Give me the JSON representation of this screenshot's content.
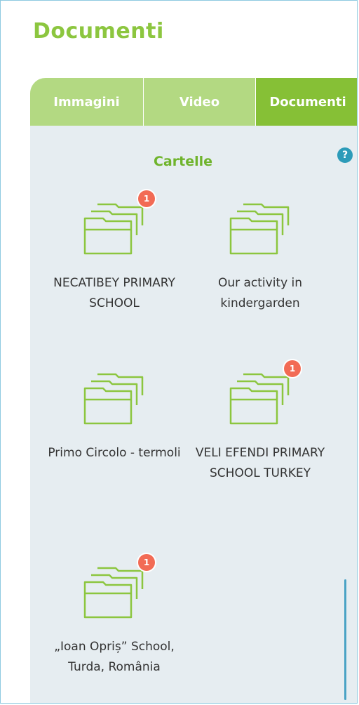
{
  "page_title": "Documenti",
  "tabs": [
    {
      "label": "Immagini",
      "active": false
    },
    {
      "label": "Video",
      "active": false
    },
    {
      "label": "Documenti",
      "active": true
    }
  ],
  "section": {
    "title": "Cartelle",
    "help_symbol": "?"
  },
  "folders": [
    {
      "label": "NECATIBEY PRIMARY SCHOOL",
      "badge": "1"
    },
    {
      "label": "Our activity in kindergarden",
      "badge": ""
    },
    {
      "label": "Primo Circolo - termoli",
      "badge": ""
    },
    {
      "label": "VELI EFENDI PRIMARY SCHOOL TURKEY",
      "badge": "1"
    },
    {
      "label": "„Ioan Opriș” School, Turda, România",
      "badge": "1"
    }
  ],
  "colors": {
    "brand_green": "#8cc63f",
    "tab_inactive": "#b3d982",
    "tab_active": "#86c036",
    "panel_bg": "#e6edf1",
    "folder_stroke": "#8cc63f",
    "badge": "#f26b55",
    "help": "#2c9bb9"
  }
}
